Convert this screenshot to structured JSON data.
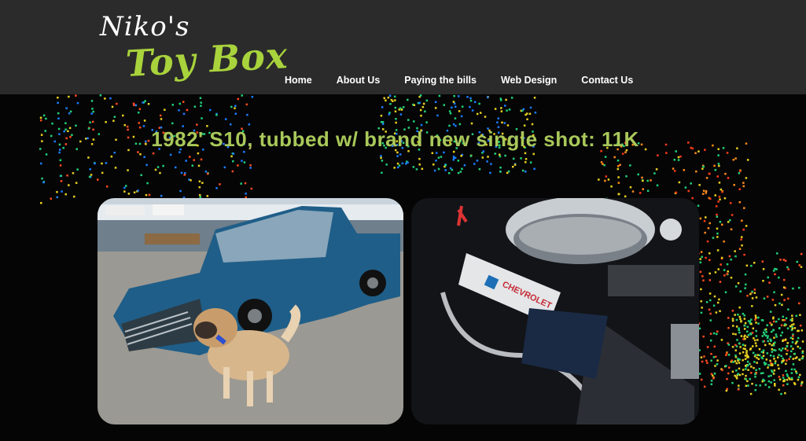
{
  "logo": {
    "line1": "Niko's",
    "line2": "Toy Box"
  },
  "nav": [
    {
      "label": "Home"
    },
    {
      "label": "About Us"
    },
    {
      "label": "Paying the bills"
    },
    {
      "label": "Web Design"
    },
    {
      "label": "Contact Us"
    }
  ],
  "headline": "1982' S10, tubbed w/ brand new single shot: 11K",
  "photos": [
    {
      "subject": "truck-with-dog"
    },
    {
      "subject": "chevrolet-engine",
      "valve_cover_text": "CHEVROLET"
    }
  ],
  "colors": {
    "header_bg": "#2b2b2b",
    "accent": "#a9d33c",
    "headline": "#a9c85a"
  }
}
